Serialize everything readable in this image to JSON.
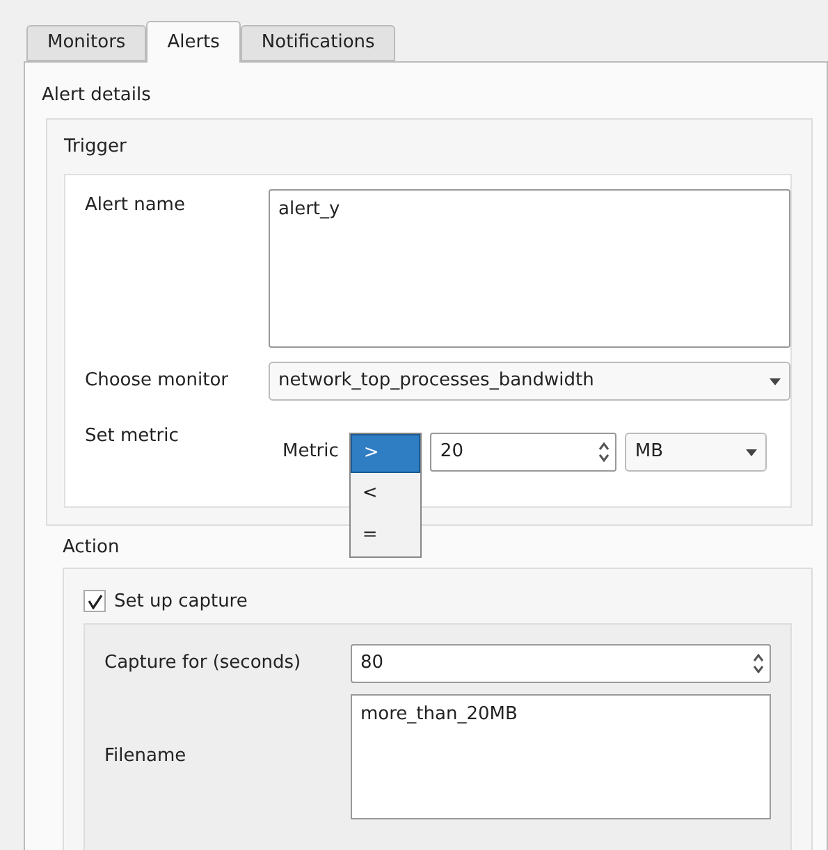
{
  "tabs": [
    {
      "label": "Monitors",
      "selected": false
    },
    {
      "label": "Alerts",
      "selected": true
    },
    {
      "label": "Notifications",
      "selected": false
    }
  ],
  "alert_details": {
    "title": "Alert details",
    "trigger": {
      "title": "Trigger",
      "alert_name": {
        "label": "Alert name",
        "value": "alert_y"
      },
      "choose_monitor": {
        "label": "Choose monitor",
        "value": "network_top_processes_bandwidth"
      },
      "set_metric": {
        "label": "Set metric",
        "metric_label": "Metric",
        "operator_options": [
          {
            "label": ">",
            "selected": true
          },
          {
            "label": "<",
            "selected": false
          },
          {
            "label": "=",
            "selected": false
          }
        ],
        "threshold": "20",
        "unit": "MB"
      }
    },
    "action": {
      "title": "Action",
      "set_up_capture": {
        "label": "Set up capture",
        "checked": true
      },
      "capture_for": {
        "label": "Capture for (seconds)",
        "value": "80"
      },
      "filename": {
        "label": "Filename",
        "value": "more_than_20MB"
      }
    }
  }
}
